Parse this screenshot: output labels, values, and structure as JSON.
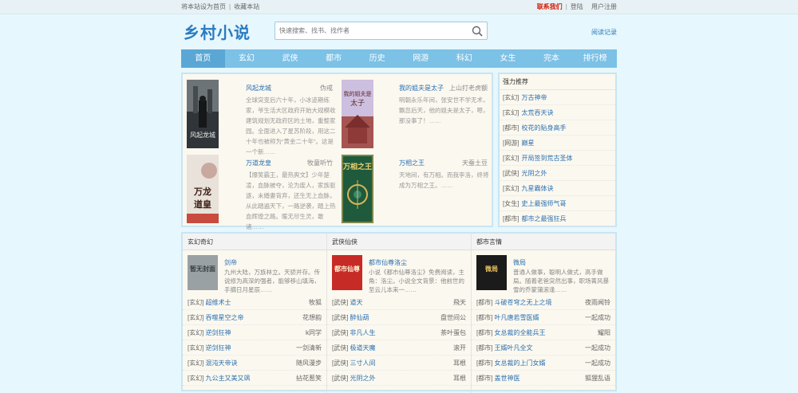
{
  "topbar": {
    "set_home": "将本站设为首页",
    "bookmark": "收藏本站",
    "contact": "联系我们",
    "login": "登陆",
    "register": "用户注册"
  },
  "header": {
    "logo": "乡村小说",
    "history": "阅读记录"
  },
  "search": {
    "placeholder": "快速搜索、找书、找作者"
  },
  "nav": {
    "items": [
      "首页",
      "玄幻",
      "武侠",
      "都市",
      "历史",
      "网游",
      "科幻",
      "女生",
      "完本",
      "排行榜"
    ]
  },
  "featured": [
    {
      "title": "风起龙城",
      "author": "伪戒",
      "desc": "全球突变后六十年，小冰迹期练家，爷生活大区政府开始大规模收建筑规划无政府区的土地，重整家园。全面进入了星苏阶段，用这二十年也被称为“黄金二十年”。这是一个新……"
    },
    {
      "title": "我的姐夫是太子",
      "author": "上山打老虎额",
      "desc": "明朝永乐年间，张安世不学无术，飘忽后天，他的姐夫是太子，嗯，那没事了！……"
    },
    {
      "title": "万道龙皇",
      "author": "牧童听竹",
      "desc": "【爆笑霸王，最热爽文】少年楚凌，血脉被夺，沦为废人，家族驱逐，未婚妻背弃，还生无上血脉，从此踏遍天下，一路逆袭，踏上热血辉煌之路。暖无尽生灵，敢诸……"
    },
    {
      "title": "万相之王",
      "author": "天蚕土豆",
      "desc": "天地间，有万相。而我李洛，终将成为万相之王。……"
    }
  ],
  "recommend": {
    "title": "强力推荐",
    "items": [
      {
        "tag": "[玄幻]",
        "name": "万古神帝"
      },
      {
        "tag": "[玄幻]",
        "name": "太荒吞天诀"
      },
      {
        "tag": "[都市]",
        "name": "校花的贴身高手"
      },
      {
        "tag": "[网游]",
        "name": "巅星"
      },
      {
        "tag": "[玄幻]",
        "name": "开局签到荒古圣体"
      },
      {
        "tag": "[武侠]",
        "name": "光阴之外"
      },
      {
        "tag": "[玄幻]",
        "name": "九星霸体诀"
      },
      {
        "tag": "[女生]",
        "name": "史上最强师气哥"
      },
      {
        "tag": "[都市]",
        "name": "都市之最强狂兵"
      }
    ]
  },
  "columns": [
    {
      "title": "玄幻奇幻",
      "feat": {
        "title": "剑帝",
        "cover_text": "暂无封面",
        "desc": "九州大陆，万族林立。天骄并存。传说修为高深的强者，能够移山填海，手摘日月星辰……"
      },
      "rows": [
        {
          "tag": "[玄幻]",
          "name": "超维术士",
          "author": "牧狐"
        },
        {
          "tag": "[玄幻]",
          "name": "吞噬星空之帝",
          "author": "花想韵"
        },
        {
          "tag": "[玄幻]",
          "name": "逆剑狂神",
          "author": "k同学"
        },
        {
          "tag": "[玄幻]",
          "name": "逆剑狂神",
          "author": "一剑清新"
        },
        {
          "tag": "[玄幻]",
          "name": "混沌天帝诀",
          "author": "随风漫步"
        },
        {
          "tag": "[玄幻]",
          "name": "九公主又美又飒",
          "author": "拈花惹笑"
        }
      ]
    },
    {
      "title": "武侠仙侠",
      "feat": {
        "title": "都市仙尊洛尘",
        "cover_text": "都市仙尊",
        "desc": "小说《都市仙尊洛尘》免费阅读，主角：洛尘。小说全文背景：他前世的至云儿本来一……"
      },
      "rows": [
        {
          "tag": "[武侠]",
          "name": "道天",
          "author": "飛天"
        },
        {
          "tag": "[武侠]",
          "name": "醉仙葫",
          "author": "盘世间公"
        },
        {
          "tag": "[武侠]",
          "name": "非凡人生",
          "author": "茶叶蛋包"
        },
        {
          "tag": "[武侠]",
          "name": "极道天魔",
          "author": "滚开"
        },
        {
          "tag": "[武侠]",
          "name": "三寸人间",
          "author": "耳根"
        },
        {
          "tag": "[武侠]",
          "name": "光阴之外",
          "author": "耳根"
        }
      ]
    },
    {
      "title": "都市言情",
      "feat": {
        "title": "微局",
        "cover_text": "微局",
        "desc": "普通人做事，聪明人做式，高手做局。随着老爸突然出事，职场菁风暴雪的乔蒙蒲滚逢……"
      },
      "rows": [
        {
          "tag": "[都市]",
          "name": "斗破苍穹之无上之境",
          "author": "夜雨闻铃"
        },
        {
          "tag": "[都市]",
          "name": "叶凡唐若雪医婿",
          "author": "一起成功"
        },
        {
          "tag": "[都市]",
          "name": "女总裁的全能兵王",
          "author": "耀阳"
        },
        {
          "tag": "[都市]",
          "name": "王婿叶凡全文",
          "author": "一起成功"
        },
        {
          "tag": "[都市]",
          "name": "女总裁的上门女婿",
          "author": "一起成功"
        },
        {
          "tag": "[都市]",
          "name": "盖世神医",
          "author": "狐狸乱语"
        }
      ]
    }
  ],
  "colors": {
    "accent": "#2a7bc0",
    "nav": "#7cc1e6",
    "link": "#2a6fb2",
    "bg": "#e6f7fd",
    "panel": "#fbf8ef"
  }
}
